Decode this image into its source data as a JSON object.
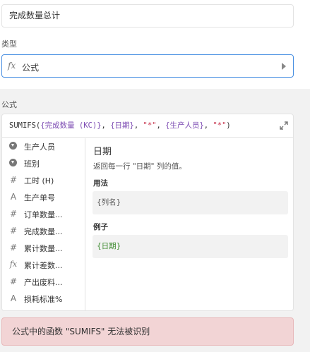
{
  "field_name": "完成数量总计",
  "type_section": {
    "label": "类型",
    "value": "公式",
    "icon": "fx-icon"
  },
  "formula_section": {
    "label": "公式",
    "formula": {
      "fn": "SUMIFS(",
      "f1": "{完成数量 (KC)}",
      "c1": ", ",
      "f2": "{日期}",
      "c2": ", ",
      "s1": "\"*\"",
      "c3": ", ",
      "f3": "{生产人员}",
      "c4": ", ",
      "s2": "\"*\"",
      "close": ")"
    }
  },
  "fields": [
    {
      "icon": "single-select-icon",
      "label": "生产人员"
    },
    {
      "icon": "single-select-icon",
      "label": "班别"
    },
    {
      "icon": "number-icon",
      "label": "工时 (H)"
    },
    {
      "icon": "text-icon",
      "label": "生产单号"
    },
    {
      "icon": "number-icon",
      "label": "订单数量..."
    },
    {
      "icon": "number-icon",
      "label": "完成数量..."
    },
    {
      "icon": "number-icon",
      "label": "累计数量..."
    },
    {
      "icon": "formula-icon",
      "label": "累计差数..."
    },
    {
      "icon": "number-icon",
      "label": "产出废料..."
    },
    {
      "icon": "text-icon",
      "label": "损耗标准%"
    }
  ],
  "help": {
    "title": "日期",
    "description": "返回每一行 \"日期\" 列的值。",
    "usage_heading": "用法",
    "usage_code": "{列名}",
    "example_heading": "例子",
    "example_code": "{日期}"
  },
  "error_message": "公式中的函数 \"SUMIFS\" 无法被识别",
  "colors": {
    "accent": "#4a90e2",
    "field_ref": "#7d4cb3",
    "string": "#c5304a",
    "example": "#3d8b2f",
    "error_bg": "#f2d4d5"
  }
}
